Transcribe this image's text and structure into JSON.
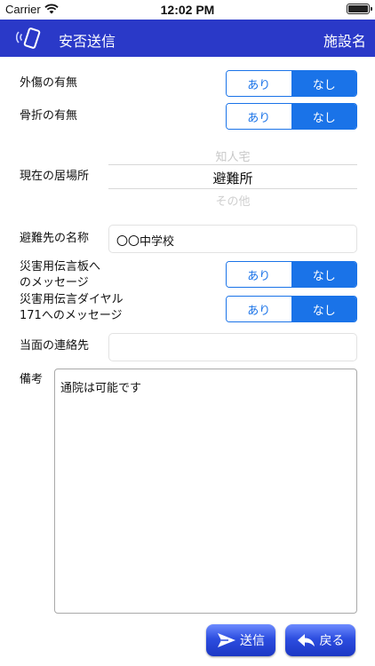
{
  "status": {
    "carrier": "Carrier",
    "time": "12:02 PM"
  },
  "nav": {
    "title": "安否送信",
    "right_label": "施設名"
  },
  "form": {
    "injury": {
      "label": "外傷の有無",
      "options": [
        "あり",
        "なし"
      ],
      "selected": "なし"
    },
    "fracture": {
      "label": "骨折の有無",
      "options": [
        "あり",
        "なし"
      ],
      "selected": "なし"
    },
    "location": {
      "label": "現在の居場所",
      "options": [
        "知人宅",
        "避難所",
        "その他"
      ],
      "selected": "避難所"
    },
    "shelter_name": {
      "label": "避難先の名称",
      "value": "〇〇中学校"
    },
    "board_message": {
      "label_line1": "災害用伝言板へ",
      "label_line2": "のメッセージ",
      "options": [
        "あり",
        "なし"
      ],
      "selected": "なし"
    },
    "dial_message": {
      "label_line1": "災害用伝言ダイヤル",
      "label_line2": "171へのメッセージ",
      "options": [
        "あり",
        "なし"
      ],
      "selected": "なし"
    },
    "contact": {
      "label": "当面の連絡先",
      "value": ""
    },
    "notes": {
      "label": "備考",
      "value": "通院は可能です"
    }
  },
  "buttons": {
    "send": "送信",
    "back": "戻る"
  },
  "colors": {
    "nav_bg": "#2a39c8",
    "accent": "#1a73e8",
    "button": "#2d4ee0"
  }
}
